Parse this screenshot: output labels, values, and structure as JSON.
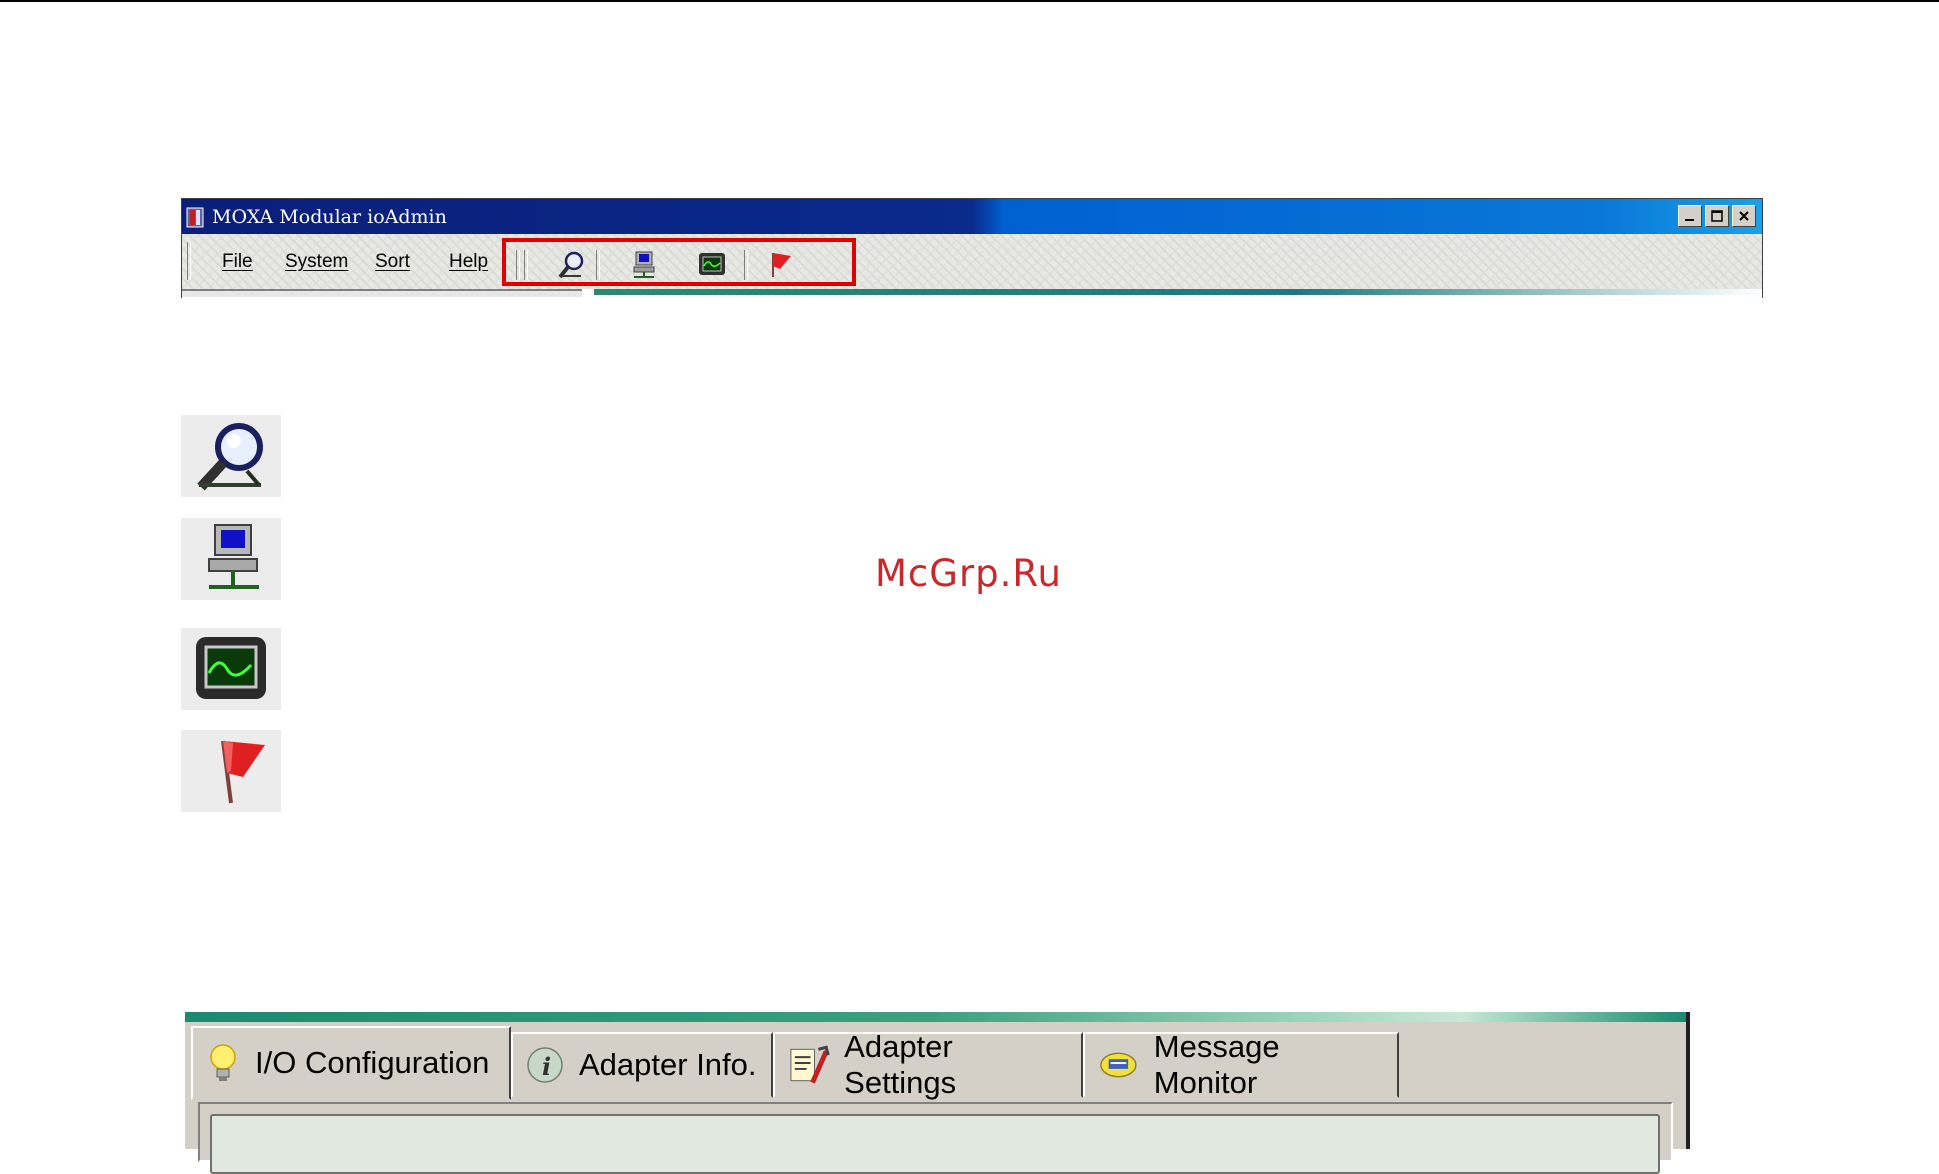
{
  "app": {
    "window_title": "MOXA Modular ioAdmin",
    "menu": [
      "File",
      "System",
      "Sort",
      "Help"
    ]
  },
  "toolbar": {
    "buttons": [
      "search-icon",
      "network-computer-icon",
      "monitor-icon",
      "flag-icon"
    ],
    "highlight_color": "#e00000"
  },
  "watermark": "McGrp.Ru",
  "tabs": [
    {
      "label": "I/O Configuration",
      "icon": "lightbulb-icon"
    },
    {
      "label": "Adapter Info.",
      "icon": "info-icon"
    },
    {
      "label": "Adapter Settings",
      "icon": "settings-icon"
    },
    {
      "label": "Message Monitor",
      "icon": "message-icon"
    }
  ]
}
